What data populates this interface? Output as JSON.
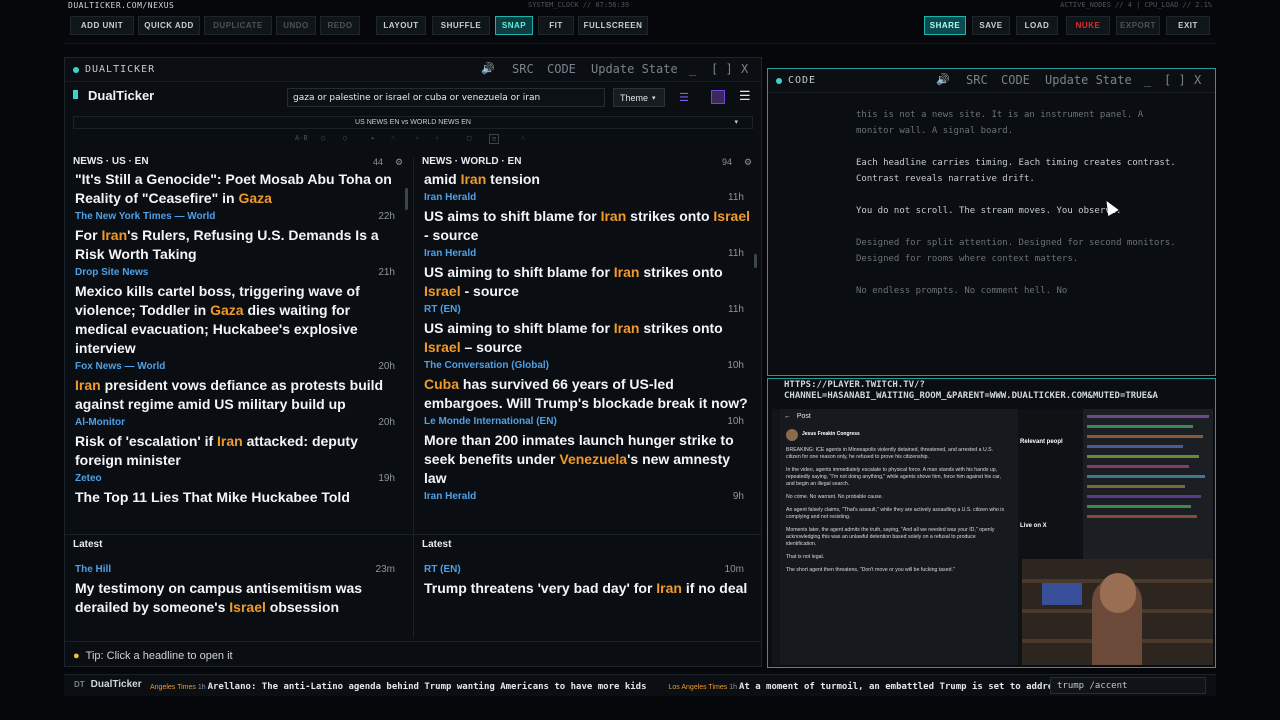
{
  "topbar": {
    "site": "DUALTICKER.COM/NEXUS",
    "sysclock": "SYSTEM_CLOCK // 07:56:39",
    "sysstats": "ACTIVE_NODES // 4 | CPU_LOAD // 2.1%",
    "buttons": {
      "add_unit": "ADD UNIT",
      "quick_add": "QUICK ADD",
      "duplicate": "DUPLICATE",
      "undo": "UNDO",
      "redo": "REDO",
      "layout": "LAYOUT",
      "shuffle": "SHUFFLE",
      "snap": "SNAP",
      "fit": "FIT",
      "fullscreen": "FULLSCREEN",
      "share": "SHARE",
      "save": "SAVE",
      "load": "LOAD",
      "nuke": "NUKE",
      "export": "EXPORT",
      "exit": "EXIT"
    }
  },
  "window_actions": {
    "src": "SRC",
    "code": "CODE",
    "update": "Update State",
    "min": "_",
    "max": "[ ]",
    "close": "X"
  },
  "dualticker": {
    "title": "DUALTICKER",
    "brand": "DualTicker",
    "search": "gaza or palestine or israel or cuba or venezuela or iran",
    "theme": "Theme",
    "feed_selector": "US NEWS EN vs WORLD NEWS EN",
    "ab_label": "A-B",
    "left_column": {
      "title": "NEWS · US · EN",
      "count": "44",
      "items": [
        {
          "source": "",
          "time": "",
          "parts": [
            "\"It's Still a Genocide\": Poet Mosab Abu Toha on Reality of \"Ceasefire\" in ",
            "Gaza",
            ""
          ]
        },
        {
          "source": "The New York Times — World",
          "time": "22h",
          "parts": [
            "For ",
            "Iran",
            "'s Rulers, Refusing U.S. Demands Is a Risk Worth Taking"
          ]
        },
        {
          "source": "Drop Site News",
          "time": "21h",
          "parts": [
            "Mexico kills cartel boss, triggering wave of violence; Toddler in ",
            "Gaza",
            " dies waiting for medical evacuation; Huckabee's explosive interview"
          ]
        },
        {
          "source": "Fox News — World",
          "time": "20h",
          "parts": [
            "",
            "Iran",
            " president vows defiance as protests build against regime amid US military build up"
          ]
        },
        {
          "source": "Al-Monitor",
          "time": "20h",
          "parts": [
            "Risk of 'escalation' if ",
            "Iran",
            " attacked: deputy foreign minister"
          ]
        },
        {
          "source": "Zeteo",
          "time": "19h",
          "parts": [
            "The Top 11 Lies That Mike Huckabee Told",
            "",
            ""
          ]
        }
      ],
      "latest_label": "Latest",
      "latest": {
        "source": "The Hill",
        "time": "23m",
        "parts": [
          "My testimony on campus antisemitism was derailed by someone's ",
          "Israel",
          " obsession"
        ]
      }
    },
    "right_column": {
      "title": "NEWS · WORLD · EN",
      "count": "94",
      "items": [
        {
          "source": "",
          "time": "",
          "parts": [
            "amid ",
            "Iran",
            " tension"
          ]
        },
        {
          "source": "Iran Herald",
          "time": "11h",
          "parts": [
            "US aims to shift blame for ",
            "Iran",
            " strikes onto ",
            "Israel",
            " - source"
          ]
        },
        {
          "source": "Iran Herald",
          "time": "11h",
          "parts": [
            "US aiming to shift blame for ",
            "Iran",
            " strikes onto ",
            "Israel",
            " - source"
          ]
        },
        {
          "source": "RT (EN)",
          "time": "11h",
          "parts": [
            "US aiming to shift blame for ",
            "Iran",
            " strikes onto ",
            "Israel",
            " – source"
          ]
        },
        {
          "source": "The Conversation (Global)",
          "time": "10h",
          "parts": [
            "",
            "Cuba",
            " has survived 66 years of US-led embargoes. Will Trump's blockade break it now?"
          ]
        },
        {
          "source": "Le Monde International (EN)",
          "time": "10h",
          "parts": [
            "More than 200 inmates launch hunger strike to seek benefits under ",
            "Venezuela",
            "'s new amnesty law"
          ]
        },
        {
          "source": "Iran Herald",
          "time": "9h",
          "parts": [
            "",
            "",
            ""
          ]
        }
      ],
      "latest_label": "Latest",
      "latest": {
        "source": "RT (EN)",
        "time": "10m",
        "parts": [
          "Trump threatens 'very bad day' for ",
          "Iran",
          " if no deal"
        ]
      }
    },
    "tip": "Tip: Click a headline to open it"
  },
  "code_window": {
    "title": "CODE",
    "lines": [
      {
        "t": "this is not a news site. It is an instrument panel. A monitor wall. A signal board.",
        "dim": true
      },
      {
        "t": "",
        "dim": false
      },
      {
        "t": "Each headline carries timing. Each timing creates contrast. Contrast reveals narrative drift.",
        "dim": false
      },
      {
        "t": "",
        "dim": false
      },
      {
        "t": "You do not scroll. The stream moves. You observe.",
        "dim": false
      },
      {
        "t": "",
        "dim": false
      },
      {
        "t": "Designed for split attention. Designed for second monitors. Designed for rooms where context matters.",
        "dim": true
      },
      {
        "t": "",
        "dim": false
      },
      {
        "t": "No endless prompts. No comment hell. No",
        "dim": true
      }
    ]
  },
  "twitch": {
    "url": "HTTPS://PLAYER.TWITCH.TV/?CHANNEL=HASANABI_WAITING_ROOM_&PARENT=WWW.DUALTICKER.COM&MUTED=TRUE&A",
    "post_header": "Post",
    "post_author": "Jesus Freakin Congress",
    "post_text": "BREAKING: ICE agents in Minneapolis violently detained, threatened, and arrested a U.S. citizen for one reason only, he refused to prove his citizenship.",
    "post_text2": "In the video, agents immediately escalate to physical force. A man stands with his hands up, repeatedly saying, \"I'm not doing anything,\" while agents shove him, force him against his car, and begin an illegal search.",
    "post_text3": "No crime. No warrant. No probable cause.",
    "post_text4": "An agent falsely claims, \"That's assault,\" while they are actively assaulting a U.S. citizen who is complying and not resisting.",
    "post_text5": "Moments later, the agent admits the truth, saying, \"And all we needed was your ID,\" openly acknowledging this was an unlawful detention based solely on a refusal to produce identification.",
    "post_text6": "That is not legal.",
    "post_text7": "The short agent then threatens, \"Don't move or you will be fucking tased.\"",
    "side_title": "Relevant peopl",
    "live_label": "Live on X"
  },
  "ticker": {
    "brand": "DualTicker",
    "items": [
      {
        "source": "Angeles Times",
        "time": "1h",
        "text": "Arellano: The anti-Latino agenda behind ",
        "kw": "Trump",
        "rest": " wanting Americans to have more kids"
      },
      {
        "source": "Los Angeles Times",
        "time": "1h",
        "text": "At a moment of turmoil, an embattled ",
        "kw": "Trump",
        "rest": " is set to address"
      }
    ],
    "input": "trump /accent"
  },
  "colors": {
    "accent": "#3bd4cc",
    "keyword": "#f09a2a",
    "source": "#4ea0e8",
    "nuke": "#d93030"
  }
}
